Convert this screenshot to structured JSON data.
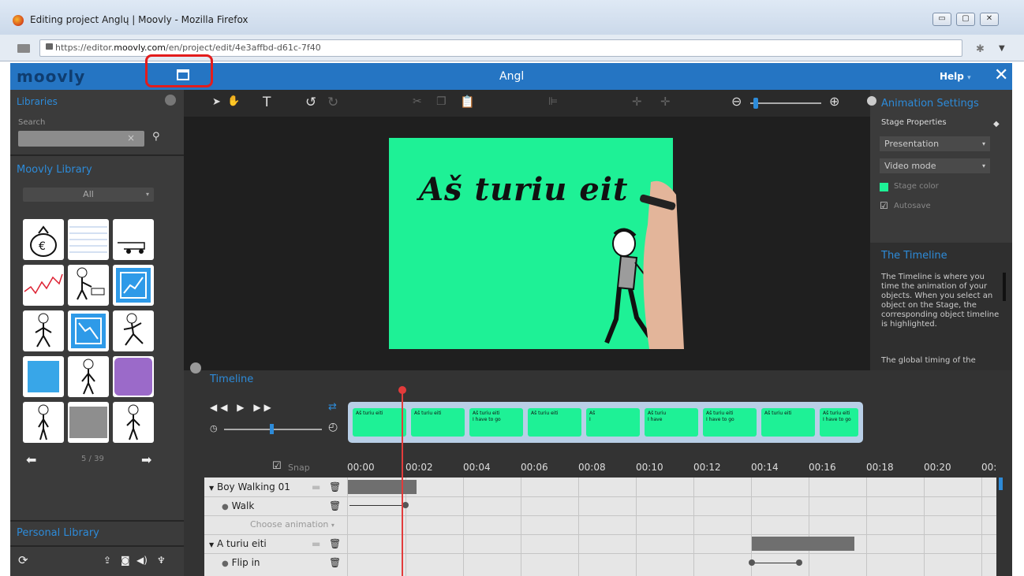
{
  "browser": {
    "window_title": "Editing project Anglų | Moovly - Mozilla Firefox",
    "url_prefix": "https://editor.",
    "url_domain": "moovly.com",
    "url_path": "/en/project/edit/4e3affbd-d61c-7f40",
    "min": "▭",
    "max": "▢",
    "close": "✕"
  },
  "app": {
    "logo": "moovly",
    "project_name": "Angl",
    "help_label": "Help",
    "help_arrow": "▾",
    "close_label": "✕",
    "highlight_color": "#e31c1c",
    "accent": "#2575c3"
  },
  "left": {
    "libraries": "Libraries",
    "search_label": "Search",
    "moovly_library": "Moovly Library",
    "category": "All",
    "page": "5 / 39",
    "personal_library": "Personal Library"
  },
  "stage": {
    "text": "Aš turiu eit",
    "color": "#1ef196"
  },
  "right": {
    "title": "Animation Settings",
    "stage_properties": "Stage Properties",
    "presentation": "Presentation",
    "video_mode": "Video mode",
    "stage_color": "Stage color",
    "autosave": "Autosave",
    "timeline_title": "The Timeline",
    "timeline_text": "The Timeline is where you time the animation of your objects. When you select an object on the Stage, the corresponding object timeline is highlighted.",
    "timeline_more": "The global timing of the"
  },
  "timeline": {
    "title": "Timeline",
    "snap": "Snap",
    "ticks": [
      "00:00",
      "00:02",
      "00:04",
      "00:06",
      "00:08",
      "00:10",
      "00:12",
      "00:14",
      "00:16",
      "00:18",
      "00:20",
      "00:"
    ],
    "frames": [
      {
        "l1": "Aš turiu eiti",
        "l2": ""
      },
      {
        "l1": "Aš turiu eiti",
        "l2": ""
      },
      {
        "l1": "Aš turiu eiti",
        "l2": "I have to go"
      },
      {
        "l1": "Aš turiu eiti",
        "l2": ""
      },
      {
        "l1": "Aš",
        "l2": "I"
      },
      {
        "l1": "Aš turiu",
        "l2": "I have"
      },
      {
        "l1": "Aš turiu eiti",
        "l2": "I have to go"
      },
      {
        "l1": "Aš turiu eiti",
        "l2": ""
      },
      {
        "l1": "Aš turiu eiti",
        "l2": "I have to go"
      }
    ],
    "rows": {
      "r1": "Boy Walking 01",
      "r2": "Walk",
      "r3": "Choose animation",
      "r4": "A turiu eiti",
      "r5": "Flip in"
    }
  }
}
